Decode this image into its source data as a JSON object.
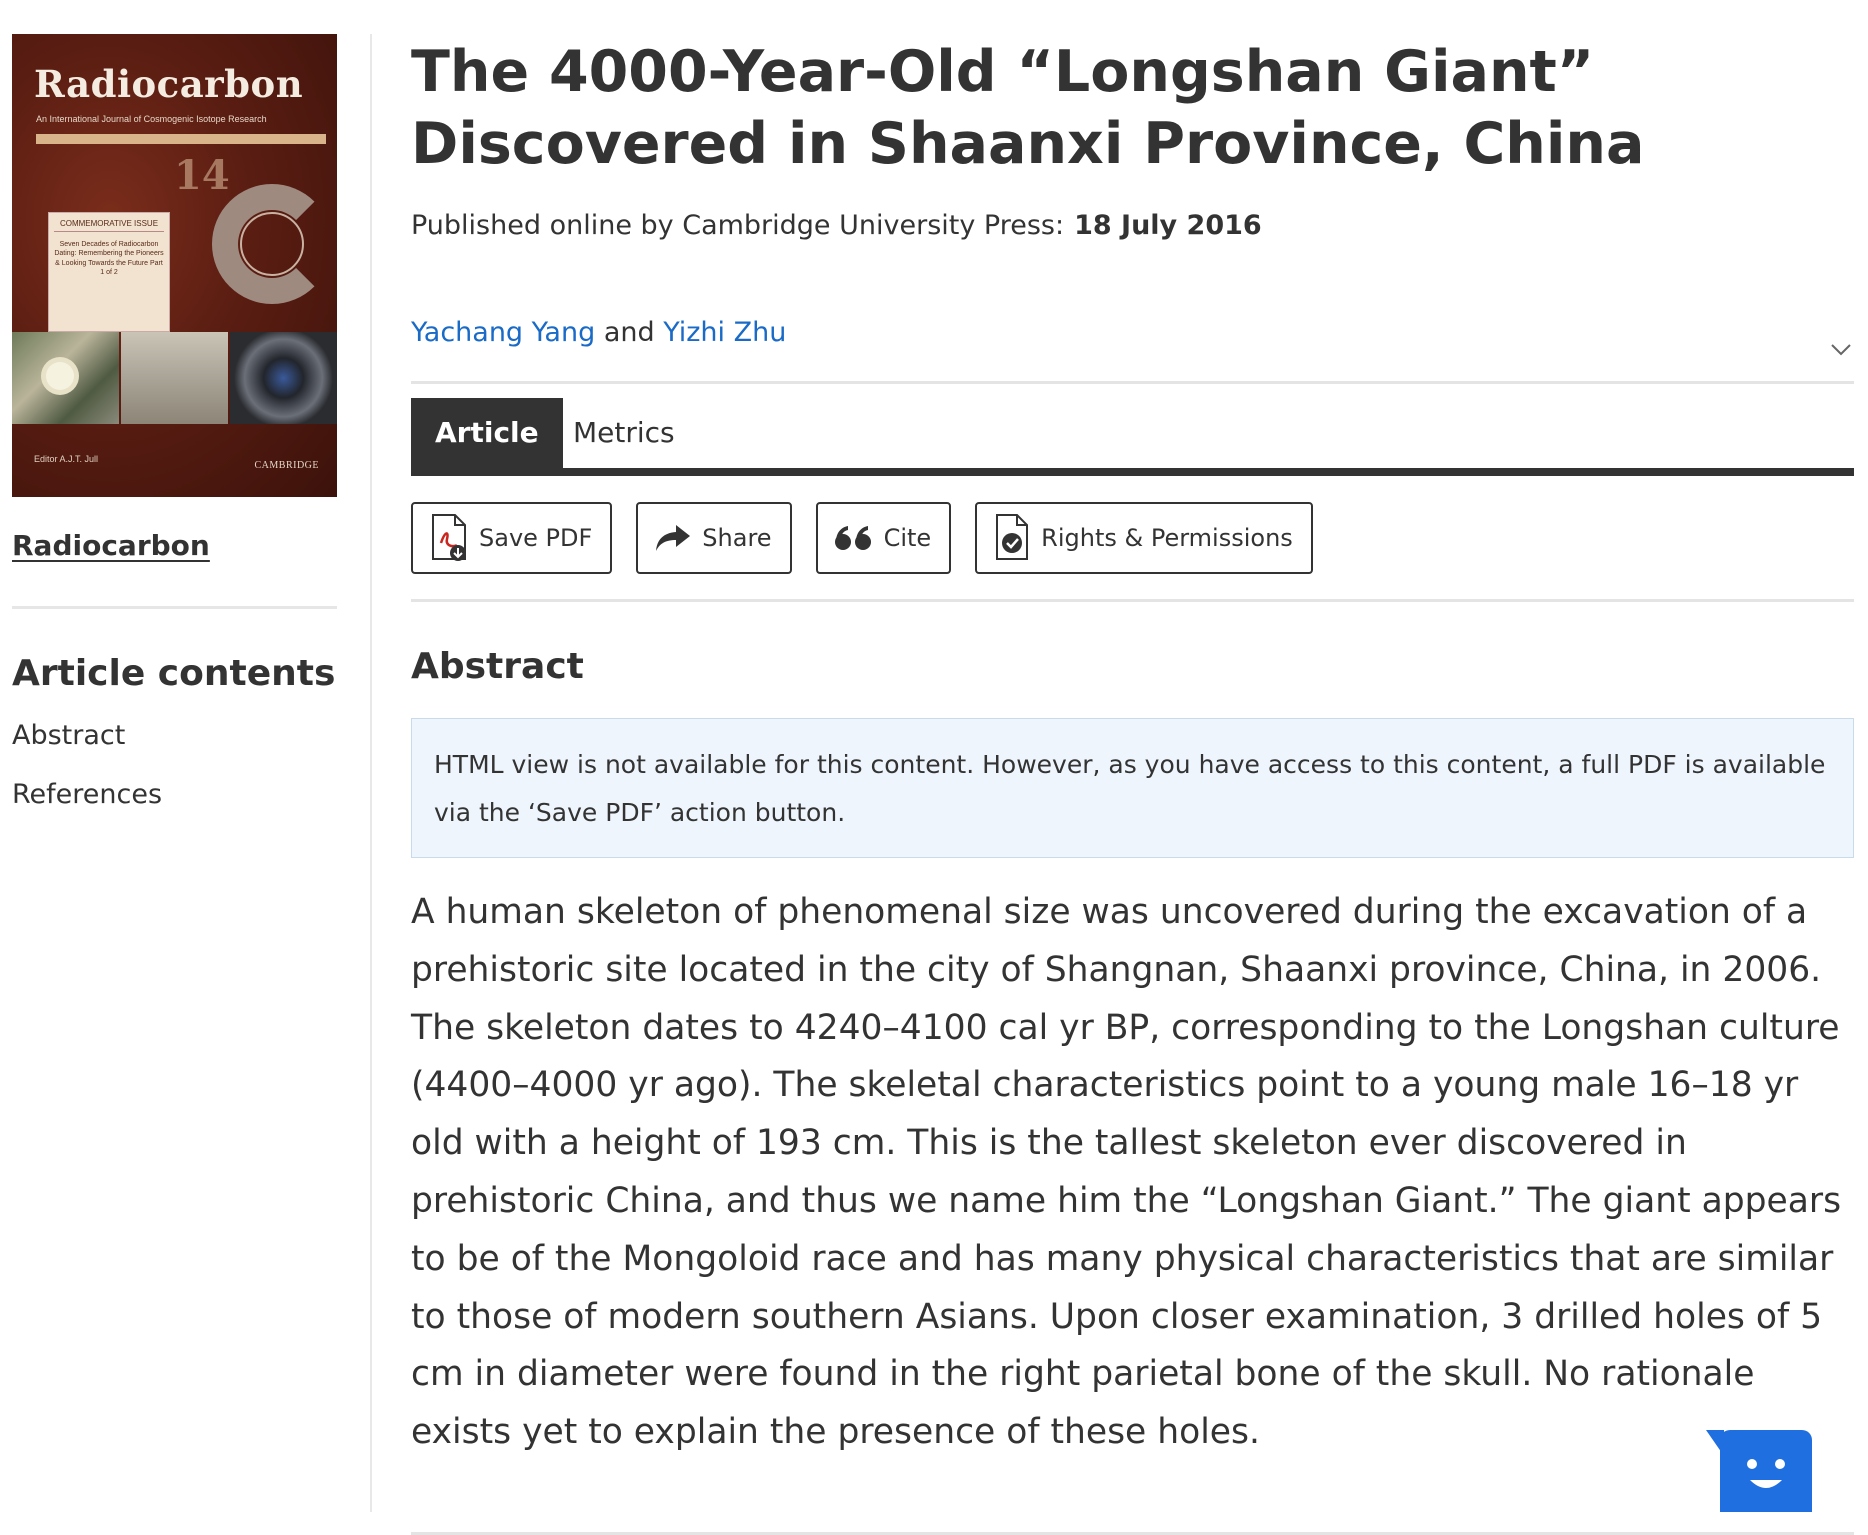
{
  "sidebar": {
    "cover": {
      "title": "Radiocarbon",
      "subtitle": "An International Journal of Cosmogenic Isotope Research",
      "badge_heading": "COMMEMORATIVE ISSUE",
      "badge_text": "Seven Decades of Radiocarbon Dating: Remembering the Pioneers & Looking Towards the Future Part 1 of 2",
      "big_number": "14",
      "editor": "Editor A.J.T. Jull",
      "publisher": "CAMBRIDGE"
    },
    "journal_link": "Radiocarbon",
    "contents_heading": "Article contents",
    "contents_items": [
      "Abstract",
      "References"
    ]
  },
  "article": {
    "title": "The 4000-Year-Old “Longshan Giant” Discovered in Shaanxi Province, China",
    "published_label": "Published online by Cambridge University Press:",
    "published_date": "18 July 2016",
    "authors": [
      "Yachang Yang",
      "Yizhi Zhu"
    ],
    "authors_joiner": "and"
  },
  "tabs": [
    {
      "label": "Article",
      "active": true
    },
    {
      "label": "Metrics",
      "active": false
    }
  ],
  "actions": {
    "save_pdf": "Save PDF",
    "share": "Share",
    "cite": "Cite",
    "rights": "Rights & Permissions"
  },
  "abstract": {
    "heading": "Abstract",
    "notice": "HTML view is not available for this content. However, as you have access to this content, a full PDF is available via the ‘Save PDF’ action button.",
    "text": "A human skeleton of phenomenal size was uncovered during the excavation of a prehistoric site located in the city of Shangnan, Shaanxi province, China, in 2006. The skeleton dates to 4240–4100 cal yr BP, corresponding to the Longshan culture (4400–4000 yr ago). The skeletal characteristics point to a young male 16–18 yr old with a height of 193 cm. This is the tallest skeleton ever discovered in prehistoric China, and thus we name him the “Longshan Giant.” The giant appears to be of the Mongoloid race and has many physical characteristics that are similar to those of modern southern Asians. Upon closer examination, 3 drilled holes of 5 cm in diameter were found in the right parietal bone of the skull. No rationale exists yet to explain the presence of these holes."
  },
  "colors": {
    "link": "#1a6bc7",
    "tab_active_bg": "#333333",
    "notice_bg": "#eef5fc",
    "chat_button": "#1f6fe0"
  },
  "icons": {
    "save_pdf": "pdf-download-icon",
    "share": "share-arrow-icon",
    "cite": "quote-icon",
    "rights": "document-check-icon",
    "expand": "chevron-down-icon",
    "chat": "chat-bot-icon"
  }
}
